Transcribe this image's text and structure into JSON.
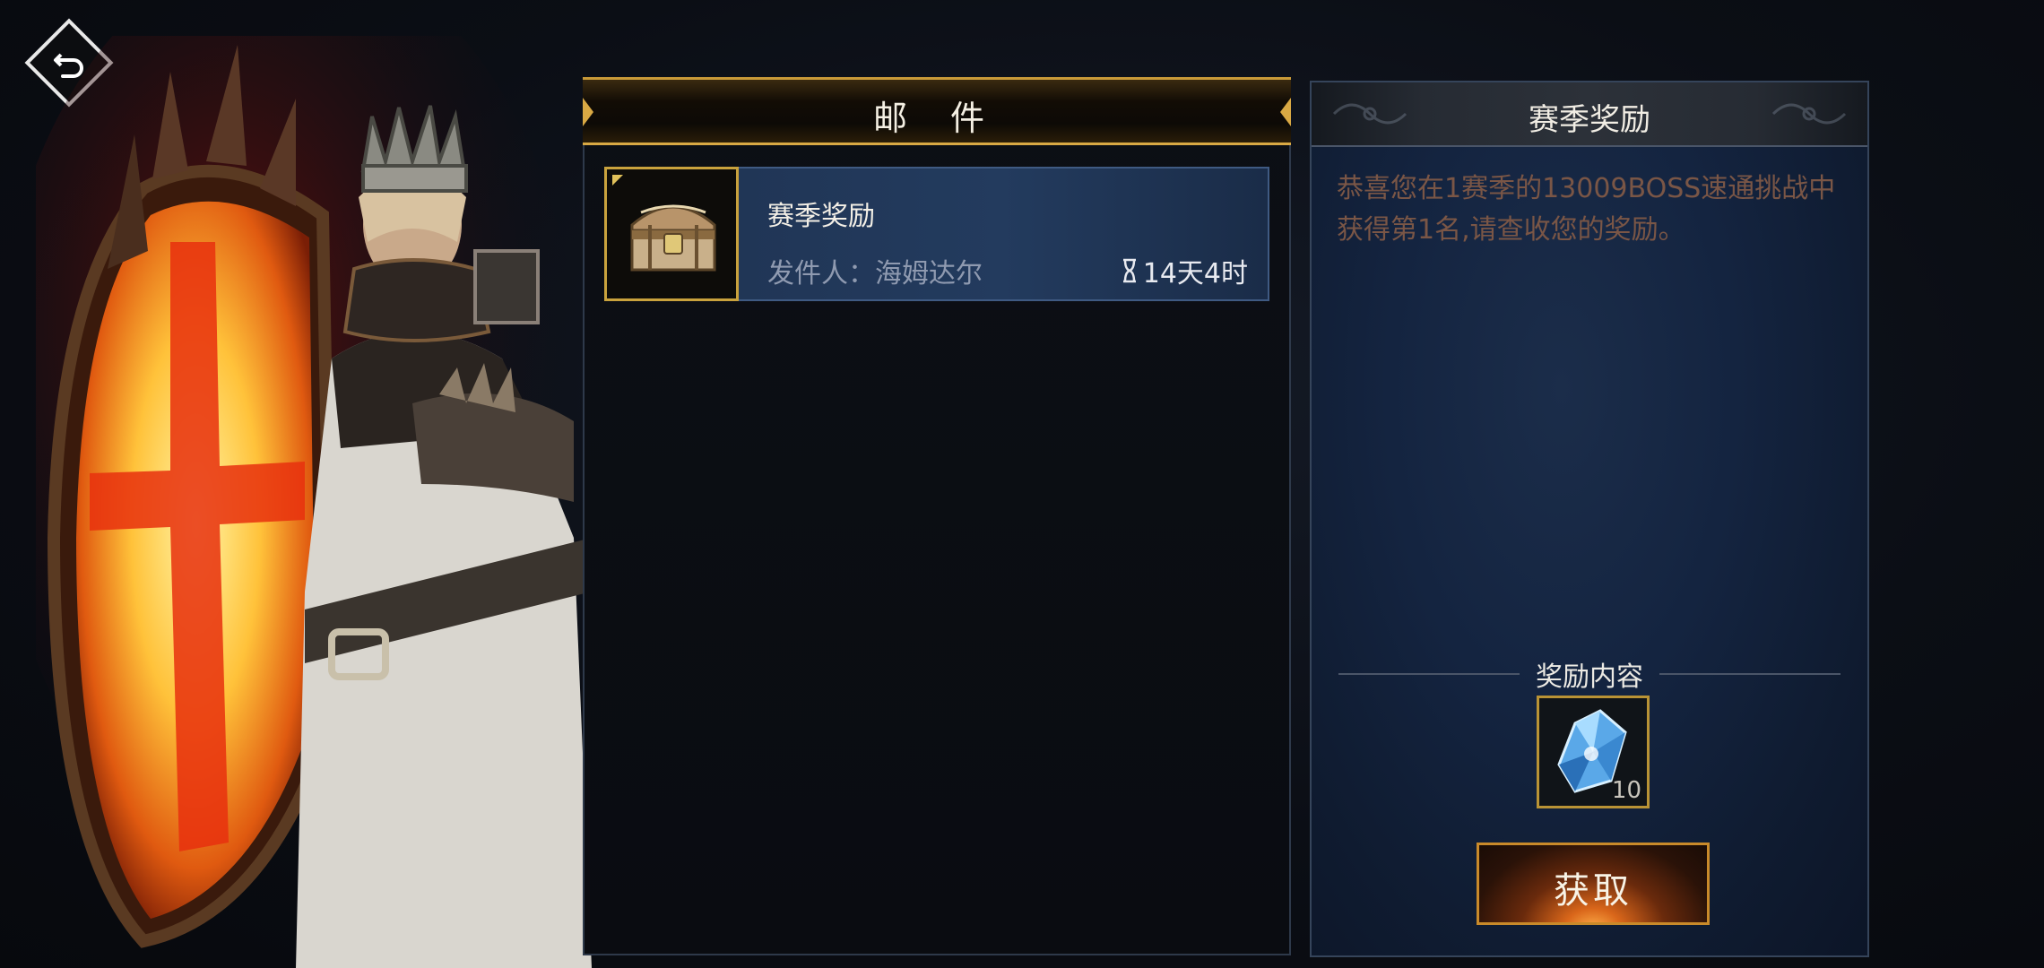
{
  "header": {
    "back_icon": "return-arrow-icon"
  },
  "mail": {
    "title": "邮 件",
    "items": [
      {
        "subject": "赛季奖励",
        "sender": "发件人：海姆达尔",
        "timer": "14天4时",
        "icon": "treasure-chest-icon"
      }
    ]
  },
  "reward": {
    "title": "赛季奖励",
    "message": "恭喜您在1赛季的13009BOSS速通挑战中获得第1名,请查收您的奖励。",
    "contents_label": "奖励内容",
    "item": {
      "icon": "blue-crystal-icon",
      "count": "10"
    },
    "claim_label": "获取"
  },
  "colors": {
    "gold_accent": "#d9a944",
    "mail_item_bg": "#233b5e",
    "reward_panel_bg": "#142440",
    "message_text": "#7a5646"
  }
}
